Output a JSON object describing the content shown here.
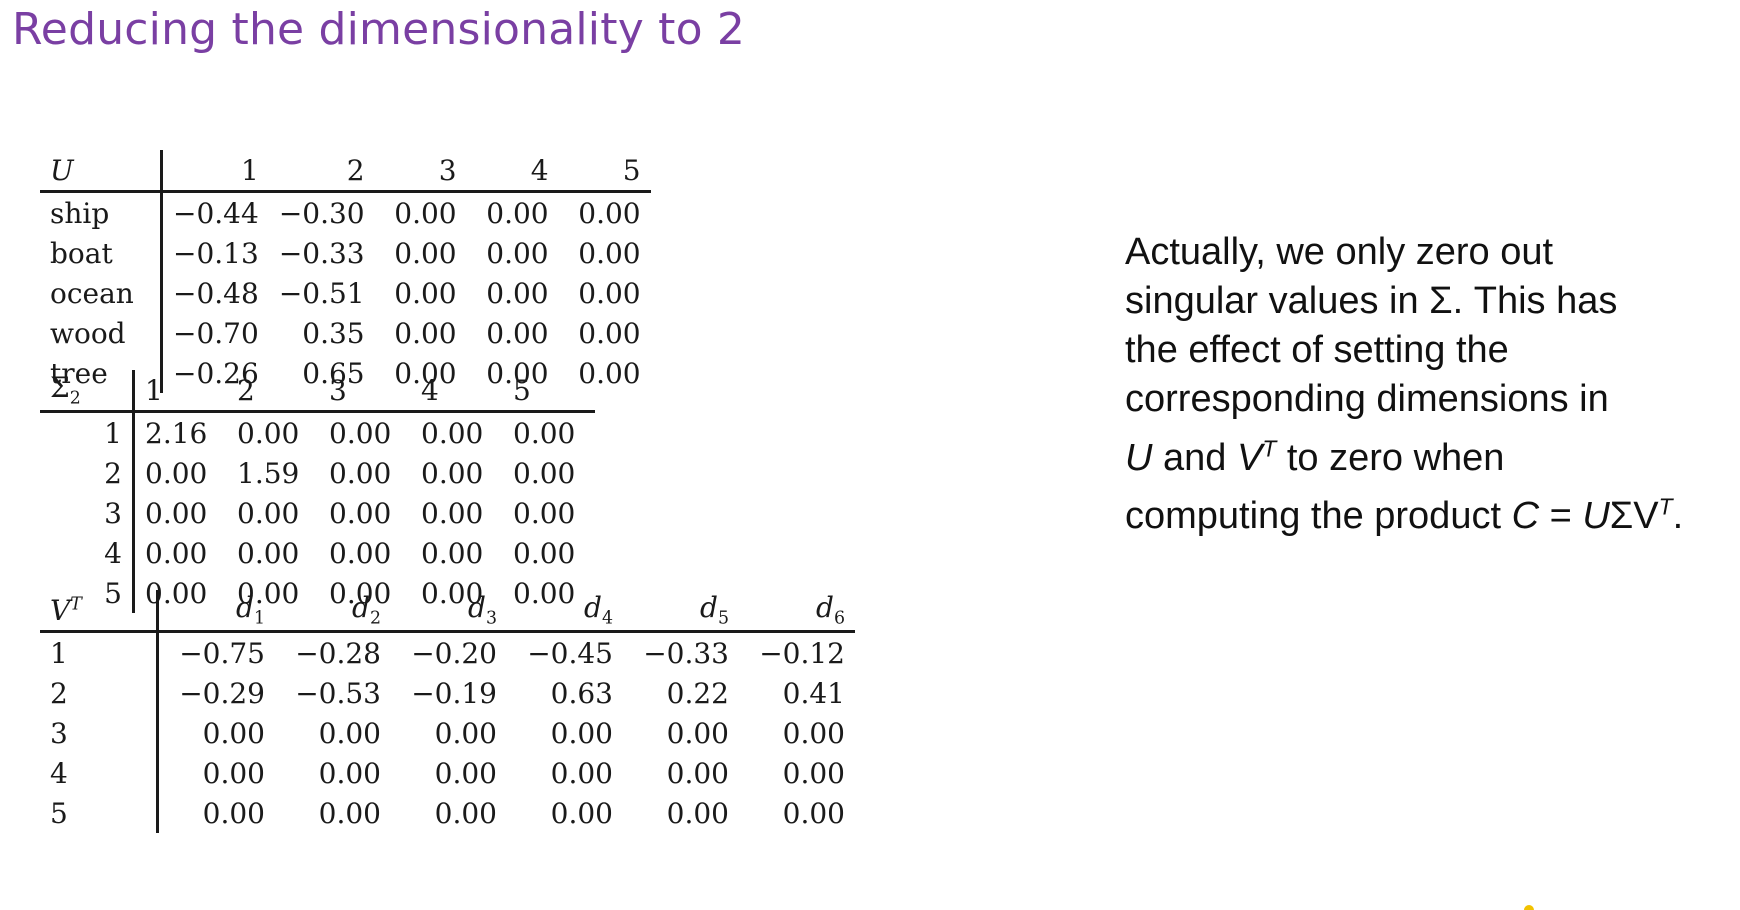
{
  "title": "Reducing the dimensionality to 2",
  "u_matrix": {
    "label": "U",
    "columns": [
      "1",
      "2",
      "3",
      "4",
      "5"
    ],
    "rows": [
      {
        "label": "ship",
        "values": [
          "−0.44",
          "−0.30",
          "0.00",
          "0.00",
          "0.00"
        ]
      },
      {
        "label": "boat",
        "values": [
          "−0.13",
          "−0.33",
          "0.00",
          "0.00",
          "0.00"
        ]
      },
      {
        "label": "ocean",
        "values": [
          "−0.48",
          "−0.51",
          "0.00",
          "0.00",
          "0.00"
        ]
      },
      {
        "label": "wood",
        "values": [
          "−0.70",
          "0.35",
          "0.00",
          "0.00",
          "0.00"
        ]
      },
      {
        "label": "tree",
        "values": [
          "−0.26",
          "0.65",
          "0.00",
          "0.00",
          "0.00"
        ]
      }
    ]
  },
  "sigma_matrix": {
    "label": "Σ",
    "label_sub": "2",
    "columns": [
      "1",
      "2",
      "3",
      "4",
      "5"
    ],
    "rows": [
      {
        "label": "1",
        "values": [
          "2.16",
          "0.00",
          "0.00",
          "0.00",
          "0.00"
        ]
      },
      {
        "label": "2",
        "values": [
          "0.00",
          "1.59",
          "0.00",
          "0.00",
          "0.00"
        ]
      },
      {
        "label": "3",
        "values": [
          "0.00",
          "0.00",
          "0.00",
          "0.00",
          "0.00"
        ]
      },
      {
        "label": "4",
        "values": [
          "0.00",
          "0.00",
          "0.00",
          "0.00",
          "0.00"
        ]
      },
      {
        "label": "5",
        "values": [
          "0.00",
          "0.00",
          "0.00",
          "0.00",
          "0.00"
        ]
      }
    ]
  },
  "vt_matrix": {
    "label": "V",
    "label_sup": "T",
    "columns": [
      {
        "base": "d",
        "sub": "1"
      },
      {
        "base": "d",
        "sub": "2"
      },
      {
        "base": "d",
        "sub": "3"
      },
      {
        "base": "d",
        "sub": "4"
      },
      {
        "base": "d",
        "sub": "5"
      },
      {
        "base": "d",
        "sub": "6"
      }
    ],
    "rows": [
      {
        "label": "1",
        "values": [
          "−0.75",
          "−0.28",
          "−0.20",
          "−0.45",
          "−0.33",
          "−0.12"
        ]
      },
      {
        "label": "2",
        "values": [
          "−0.29",
          "−0.53",
          "−0.19",
          "0.63",
          "0.22",
          "0.41"
        ]
      },
      {
        "label": "3",
        "values": [
          "0.00",
          "0.00",
          "0.00",
          "0.00",
          "0.00",
          "0.00"
        ]
      },
      {
        "label": "4",
        "values": [
          "0.00",
          "0.00",
          "0.00",
          "0.00",
          "0.00",
          "0.00"
        ]
      },
      {
        "label": "5",
        "values": [
          "0.00",
          "0.00",
          "0.00",
          "0.00",
          "0.00",
          "0.00"
        ]
      }
    ]
  },
  "note": {
    "line1": "Actually, we only zero out",
    "line2": "singular values in Σ. This has",
    "line3": "the effect of setting the",
    "line4": "corresponding dimensions in",
    "line5_u": "U",
    "line5_and": " and ",
    "line5_v": "V",
    "line5_sup": "T",
    "line5_rest": " to zero when",
    "line6_pre": "computing the product ",
    "line6_c": "C",
    "line6_eq": " = ",
    "line6_u": "U",
    "line6_sigma": "Σ",
    "line6_v": "V",
    "line6_sup": "T",
    "line6_end": "."
  },
  "colors": {
    "title": "#7a3fa3",
    "accent_dot": "#f2c200"
  }
}
